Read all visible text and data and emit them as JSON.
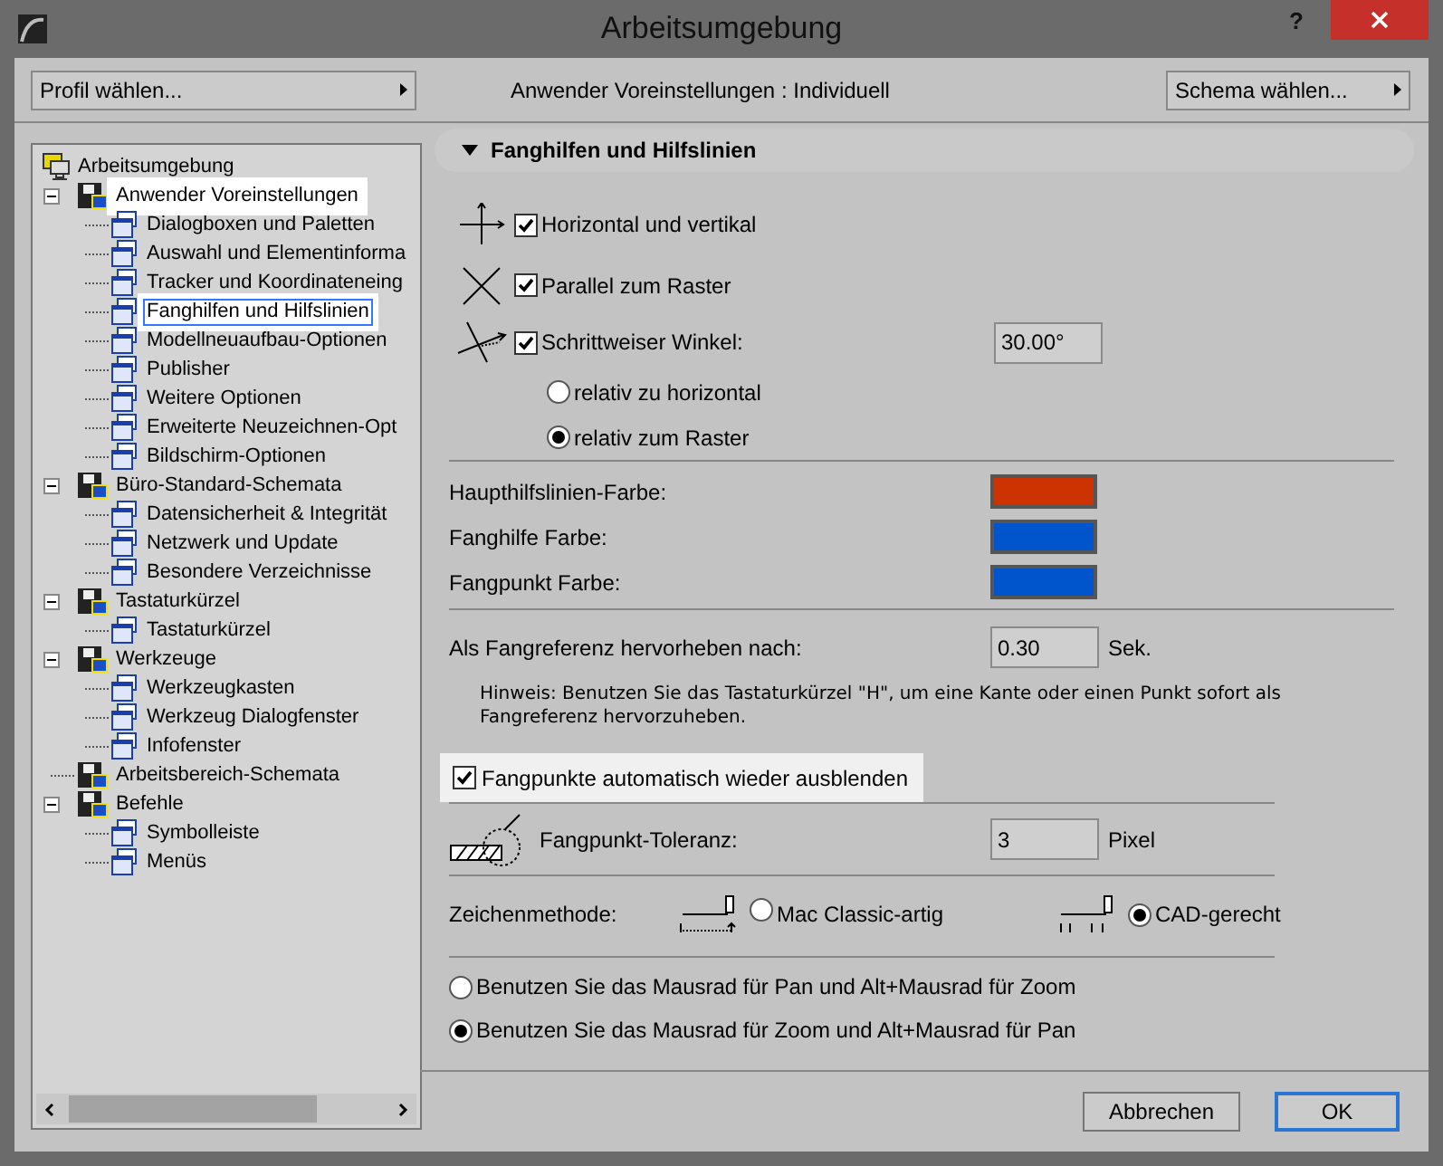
{
  "window": {
    "title": "Arbeitsumgebung",
    "help": "?"
  },
  "top_bar": {
    "profile_button": "Profil wählen...",
    "status": "Anwender Voreinstellungen : Individuell",
    "scheme_button": "Schema wählen..."
  },
  "tree": [
    {
      "label": "Arbeitsumgebung",
      "selected": false,
      "highlighted": false,
      "children": [
        {
          "label": "Anwender Voreinstellungen",
          "expanded": true,
          "selected": false,
          "highlighted": true,
          "children": [
            {
              "label": "Dialogboxen und Paletten",
              "selected": false,
              "highlighted": false
            },
            {
              "label": "Auswahl und Elementinforma",
              "selected": false,
              "highlighted": false
            },
            {
              "label": "Tracker und Koordinateneing",
              "selected": false,
              "highlighted": false
            },
            {
              "label": "Fanghilfen und Hilfslinien",
              "selected": true,
              "highlighted": true
            },
            {
              "label": "Modellneuaufbau-Optionen",
              "selected": false,
              "highlighted": false
            },
            {
              "label": "Publisher",
              "selected": false,
              "highlighted": false
            },
            {
              "label": "Weitere Optionen",
              "selected": false,
              "highlighted": false
            },
            {
              "label": "Erweiterte Neuzeichnen-Opt",
              "selected": false,
              "highlighted": false
            },
            {
              "label": "Bildschirm-Optionen",
              "selected": false,
              "highlighted": false
            }
          ]
        },
        {
          "label": "Büro-Standard-Schemata",
          "expanded": true,
          "selected": false,
          "highlighted": false,
          "children": [
            {
              "label": "Datensicherheit & Integrität",
              "selected": false,
              "highlighted": false
            },
            {
              "label": "Netzwerk und Update",
              "selected": false,
              "highlighted": false
            },
            {
              "label": "Besondere Verzeichnisse",
              "selected": false,
              "highlighted": false
            }
          ]
        },
        {
          "label": "Tastaturkürzel",
          "expanded": true,
          "selected": false,
          "highlighted": false,
          "children": [
            {
              "label": "Tastaturkürzel",
              "selected": false,
              "highlighted": false
            }
          ]
        },
        {
          "label": "Werkzeuge",
          "expanded": true,
          "selected": false,
          "highlighted": false,
          "children": [
            {
              "label": "Werkzeugkasten",
              "selected": false,
              "highlighted": false
            },
            {
              "label": "Werkzeug Dialogfenster",
              "selected": false,
              "highlighted": false
            },
            {
              "label": "Infofenster",
              "selected": false,
              "highlighted": false
            }
          ]
        },
        {
          "label": "Arbeitsbereich-Schemata",
          "selected": false,
          "highlighted": false
        },
        {
          "label": "Befehle",
          "expanded": true,
          "selected": false,
          "highlighted": false,
          "children": [
            {
              "label": "Symbolleiste",
              "selected": false,
              "highlighted": false
            },
            {
              "label": "Menüs",
              "selected": false,
              "highlighted": false
            }
          ]
        }
      ]
    }
  ],
  "panel": {
    "title": "Fanghilfen und Hilfslinien",
    "expanded": true,
    "snap_options": [
      {
        "label": "Horizontal und vertikal",
        "checked": true
      },
      {
        "label": "Parallel zum Raster",
        "checked": true
      },
      {
        "label": "Schrittweiser Winkel:",
        "checked": true,
        "value": "30.00°"
      }
    ],
    "angle_reference": [
      {
        "label": "relativ zu horizontal",
        "selected": false
      },
      {
        "label": "relativ zum Raster",
        "selected": true
      }
    ],
    "colors": [
      {
        "label": "Haupthilfslinien-Farbe:",
        "color": "#cc3300"
      },
      {
        "label": "Fanghilfe Farbe:",
        "color": "#0055cc"
      },
      {
        "label": "Fangpunkt Farbe:",
        "color": "#0055cc"
      }
    ],
    "highlight_delay": {
      "label": "Als Fangreferenz hervorheben nach:",
      "value": "0.30",
      "unit": "Sek."
    },
    "hint": "Hinweis: Benutzen Sie das Tastaturkürzel \"H\", um eine Kante oder einen Punkt sofort als Fangreferenz hervorzuheben.",
    "auto_hide": {
      "label": "Fangpunkte automatisch wieder ausblenden",
      "checked": true,
      "highlighted": true
    },
    "tolerance": {
      "label": "Fangpunkt-Toleranz:",
      "value": "3",
      "unit": "Pixel"
    },
    "drawing_method": {
      "label": "Zeichenmethode:",
      "options": [
        {
          "label": "Mac Classic-artig",
          "selected": false
        },
        {
          "label": "CAD-gerecht",
          "selected": true
        }
      ]
    },
    "mouse_wheel": [
      {
        "label": "Benutzen Sie das Mausrad für Pan und Alt+Mausrad für Zoom",
        "selected": false
      },
      {
        "label": "Benutzen Sie das Mausrad für Zoom und Alt+Mausrad für Pan",
        "selected": true
      }
    ]
  },
  "buttons": [
    {
      "label": "Abbrechen",
      "default": false
    },
    {
      "label": "OK",
      "default": true
    }
  ]
}
